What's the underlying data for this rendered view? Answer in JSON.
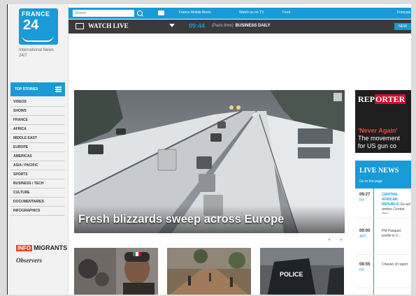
{
  "brand": {
    "line1": "FRANCE",
    "line2": "24",
    "tagline": "International News 24/7"
  },
  "search": {
    "placeholder": "Search"
  },
  "top_links": [
    "France Mobile Alerts",
    "Watch us on TV",
    "Feed",
    "Français"
  ],
  "watch_live": {
    "label": "WATCH LIVE",
    "time": "09:44",
    "show_prefix": "(Paris time)",
    "show": "BUSINESS DAILY",
    "new_label": "NEW"
  },
  "sidebar": {
    "top_stories_label": "TOP STORIES",
    "items": [
      "VIDEOS",
      "SHOWS",
      "FRANCE",
      "AFRICA",
      "MIDDLE EAST",
      "EUROPE",
      "AMERICAS",
      "ASIA / PACIFIC",
      "SPORTS",
      "BUSINESS / TECH",
      "CULTURE",
      "DOCUMENTARIES",
      "INFOGRAPHICS"
    ],
    "migrants_info": "INFO",
    "migrants_label": "MIGRANTS",
    "observers_label": "Observers"
  },
  "hero": {
    "title": "Fresh blizzards sweep across Europe"
  },
  "reporters": {
    "brand_a": "REP",
    "brand_b": "ORTER",
    "headline": "'Never Again'",
    "sub1": "The movement",
    "sub2": "for US gun co"
  },
  "live_news": {
    "title": "LIVE NEWS",
    "subtitle": "Go to the page",
    "items": [
      {
        "time": "09:27",
        "tz": "FR",
        "headline": "CENTRAL AFRICAN REPUBLIC",
        "text": "Ex aid worker Central Afric"
      },
      {
        "time": "09:00",
        "tz": "AFP",
        "headline": "",
        "text": "PM Pasquet profile in 2..."
      },
      {
        "time": "08:55",
        "tz": "FR",
        "headline": "",
        "text": "Chavan of report"
      }
    ]
  },
  "colors": {
    "accent": "#1a9ad6",
    "dark_bar": "#3a3a3a",
    "reporters_red": "#c8102e"
  }
}
